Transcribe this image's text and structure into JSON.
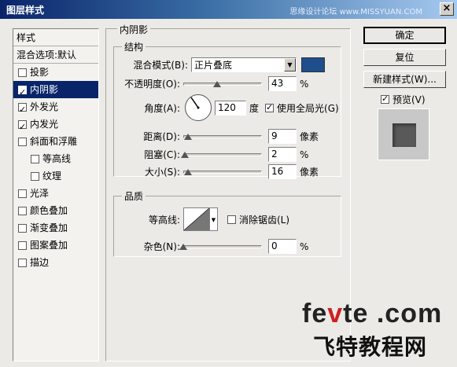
{
  "window": {
    "title": "图层样式",
    "watermark": "思缘设计论坛 www.MISSYUAN.COM",
    "close_label": "×"
  },
  "styles_list": {
    "header": "样式",
    "blend_label": "混合选项:默认",
    "items": [
      {
        "label": "投影",
        "checked": false,
        "selected": false,
        "sub": false
      },
      {
        "label": "内阴影",
        "checked": true,
        "selected": true,
        "sub": false
      },
      {
        "label": "外发光",
        "checked": true,
        "selected": false,
        "sub": false
      },
      {
        "label": "内发光",
        "checked": true,
        "selected": false,
        "sub": false
      },
      {
        "label": "斜面和浮雕",
        "checked": false,
        "selected": false,
        "sub": false
      },
      {
        "label": "等高线",
        "checked": false,
        "selected": false,
        "sub": true
      },
      {
        "label": "纹理",
        "checked": false,
        "selected": false,
        "sub": true
      },
      {
        "label": "光泽",
        "checked": false,
        "selected": false,
        "sub": false
      },
      {
        "label": "颜色叠加",
        "checked": false,
        "selected": false,
        "sub": false
      },
      {
        "label": "渐变叠加",
        "checked": false,
        "selected": false,
        "sub": false
      },
      {
        "label": "图案叠加",
        "checked": false,
        "selected": false,
        "sub": false
      },
      {
        "label": "描边",
        "checked": false,
        "selected": false,
        "sub": false
      }
    ]
  },
  "inner_shadow": {
    "panel_title": "内阴影",
    "structure": {
      "title": "结构",
      "blend_mode_label": "混合模式(B):",
      "blend_mode_value": "正片叠底",
      "color": "#1f4e8c",
      "opacity_label": "不透明度(O):",
      "opacity_value": "43",
      "opacity_unit": "%",
      "opacity_fraction": 0.43,
      "angle_label": "角度(A):",
      "angle_value": "120",
      "angle_unit": "度",
      "global_light_label": "使用全局光(G)",
      "global_light_checked": true,
      "distance_label": "距离(D):",
      "distance_value": "9",
      "distance_unit": "像素",
      "distance_fraction": 0.06,
      "choke_label": "阻塞(C):",
      "choke_value": "2",
      "choke_unit": "%",
      "choke_fraction": 0.02,
      "size_label": "大小(S):",
      "size_value": "16",
      "size_unit": "像素",
      "size_fraction": 0.06
    },
    "quality": {
      "title": "品质",
      "contour_label": "等高线:",
      "anti_alias_label": "消除锯齿(L)",
      "anti_alias_checked": false,
      "noise_label": "杂色(N):",
      "noise_value": "0",
      "noise_unit": "%",
      "noise_fraction": 0.0
    }
  },
  "buttons": {
    "ok": "确定",
    "reset": "复位",
    "new_style": "新建样式(W)...",
    "preview_label": "预览(V)",
    "preview_checked": true
  },
  "logo": {
    "en_pre": "fe",
    "en_dot": "v",
    "en_post": "te .com",
    "cn": "飞特教程网"
  }
}
